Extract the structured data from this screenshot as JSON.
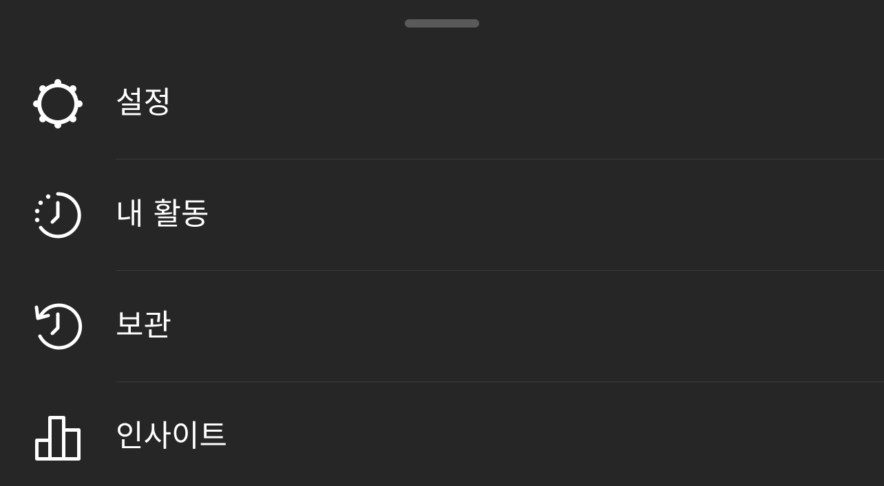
{
  "menu": {
    "items": [
      {
        "label": "설정",
        "icon": "gear-icon"
      },
      {
        "label": "내 활동",
        "icon": "activity-clock-icon"
      },
      {
        "label": "보관",
        "icon": "archive-history-icon"
      },
      {
        "label": "인사이트",
        "icon": "bar-chart-icon"
      }
    ]
  }
}
